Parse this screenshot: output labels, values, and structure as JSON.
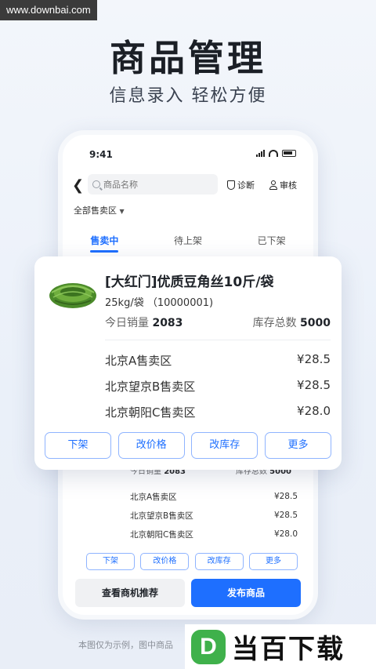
{
  "watermark": "www.downbai.com",
  "hero": {
    "title": "商品管理",
    "subtitle": "信息录入 轻松方便"
  },
  "phone": {
    "status_time": "9:41",
    "search_placeholder": "商品名称",
    "actions": {
      "diagnose": "诊断",
      "review": "审核"
    },
    "area_filter": "全部售卖区",
    "tabs": [
      {
        "label": "售卖中",
        "active": true
      },
      {
        "label": "待上架",
        "active": false
      },
      {
        "label": "已下架",
        "active": false
      }
    ],
    "small_card": {
      "sales_label": "今日销量",
      "sales_value": "2083",
      "stock_label": "库存总数",
      "stock_value": "5000",
      "regions": [
        {
          "name": "北京A售卖区",
          "price": "¥28.5"
        },
        {
          "name": "北京望京B售卖区",
          "price": "¥28.5"
        },
        {
          "name": "北京朝阳C售卖区",
          "price": "¥28.0"
        }
      ],
      "buttons": [
        "下架",
        "改价格",
        "改库存",
        "更多"
      ]
    },
    "bottom": {
      "secondary": "查看商机推荐",
      "primary": "发布商品"
    }
  },
  "product_card": {
    "title": "[大红门]优质豆角丝10斤/袋",
    "spec": "25kg/袋 （10000001)",
    "sales_label": "今日销量",
    "sales_value": "2083",
    "stock_label": "库存总数",
    "stock_value": "5000",
    "regions": [
      {
        "name": "北京A售卖区",
        "price": "¥28.5"
      },
      {
        "name": "北京望京B售卖区",
        "price": "¥28.5"
      },
      {
        "name": "北京朝阳C售卖区",
        "price": "¥28.0"
      }
    ],
    "buttons": [
      "下架",
      "改价格",
      "改库存",
      "更多"
    ]
  },
  "disclaimer": "本图仅为示例，图中商品",
  "brand": {
    "mark": "D",
    "name": "当百下载"
  },
  "colors": {
    "accent": "#1e6fff",
    "brand_green": "#3fb14b"
  }
}
